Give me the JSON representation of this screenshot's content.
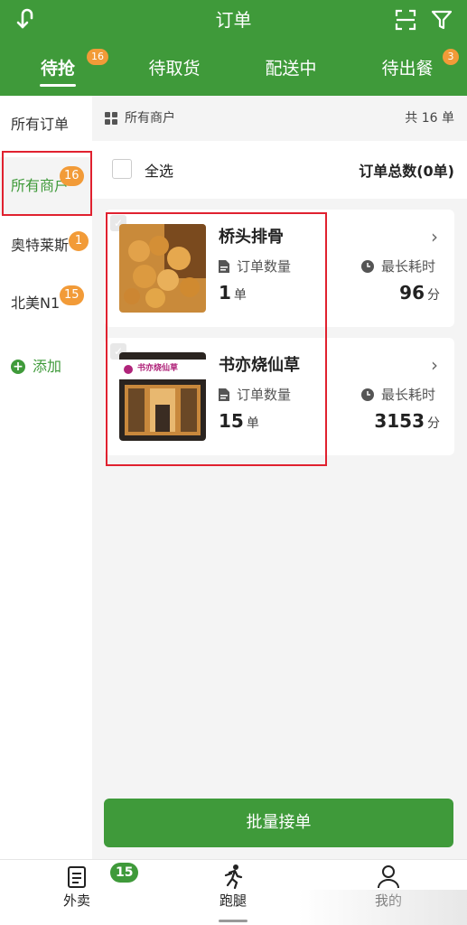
{
  "header": {
    "title": "订单",
    "tabs": [
      {
        "label": "待抢",
        "badge": "16",
        "active": true
      },
      {
        "label": "待取货",
        "badge": ""
      },
      {
        "label": "配送中",
        "badge": ""
      },
      {
        "label": "待出餐",
        "badge": "3"
      }
    ]
  },
  "sidebar": {
    "items": [
      {
        "label": "所有订单",
        "badge": ""
      },
      {
        "label": "所有商户",
        "badge": "16",
        "active": true
      },
      {
        "label": "奥特莱斯",
        "badge": "1"
      },
      {
        "label": "北美N1",
        "badge": "15"
      }
    ],
    "add_label": "添加"
  },
  "main": {
    "merchant_label": "所有商户",
    "total_count": "共 16 单",
    "select_all": "全选",
    "order_total": "订单总数(0单)",
    "cards": [
      {
        "name": "桥头排骨",
        "count_label": "订单数量",
        "count": "1",
        "count_unit": "单",
        "time_label": "最长耗时",
        "time": "96",
        "time_unit": "分"
      },
      {
        "name": "书亦烧仙草",
        "count_label": "订单数量",
        "count": "15",
        "count_unit": "单",
        "time_label": "最长耗时",
        "time": "3153",
        "time_unit": "分",
        "store_sign": "书亦烧仙草"
      }
    ],
    "batch_button": "批量接单"
  },
  "bottom_nav": {
    "items": [
      {
        "label": "外卖"
      },
      {
        "label": "跑腿"
      },
      {
        "label": "我的"
      }
    ],
    "badge": "15"
  },
  "colors": {
    "brand": "#3f9a3a",
    "badge": "#f29b38",
    "highlight": "#e0212f"
  }
}
